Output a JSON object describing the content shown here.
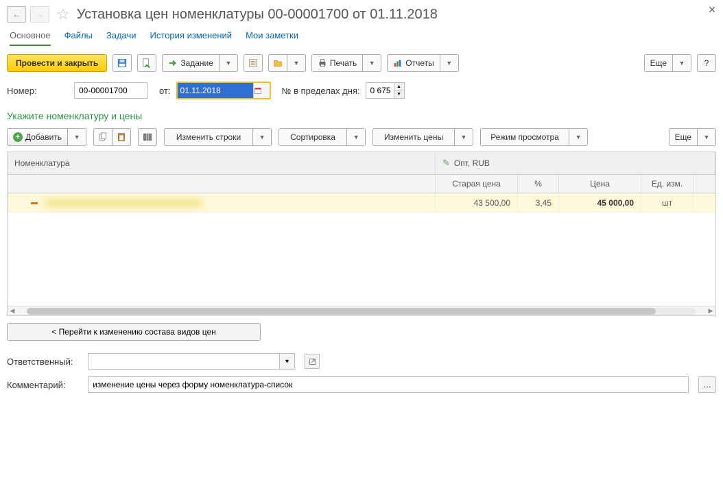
{
  "header": {
    "title": "Установка цен номенклатуры 00-00001700 от 01.11.2018"
  },
  "tabs": {
    "main": "Основное",
    "files": "Файлы",
    "tasks": "Задачи",
    "history": "История изменений",
    "notes": "Мои заметки"
  },
  "toolbar": {
    "post_close": "Провести и закрыть",
    "task": "Задание",
    "print": "Печать",
    "reports": "Отчеты",
    "more": "Еще",
    "help": "?"
  },
  "form": {
    "number_label": "Номер:",
    "number_value": "00-00001700",
    "date_label": "от:",
    "date_value": "01.11.2018",
    "day_index_label": "№ в пределах дня:",
    "day_index_value": "0 675"
  },
  "section_title": "Укажите номенклатуру и цены",
  "toolbar2": {
    "add": "Добавить",
    "edit_rows": "Изменить строки",
    "sort": "Сортировка",
    "edit_prices": "Изменить цены",
    "view_mode": "Режим просмотра",
    "more": "Еще"
  },
  "table": {
    "col_nomen": "Номенклатура",
    "col_opt": "Опт, RUB",
    "col_old_price": "Старая цена",
    "col_percent": "%",
    "col_price": "Цена",
    "col_unit": "Ед. изм.",
    "rows": [
      {
        "nomen": "",
        "old_price": "43 500,00",
        "percent": "3,45",
        "price": "45 000,00",
        "unit": "шт"
      }
    ]
  },
  "goto_button": "< Перейти к изменению состава видов цен",
  "fields": {
    "responsible_label": "Ответственный:",
    "responsible_value": "",
    "comment_label": "Комментарий:",
    "comment_value": "изменение цены через форму номенклатура-список"
  }
}
